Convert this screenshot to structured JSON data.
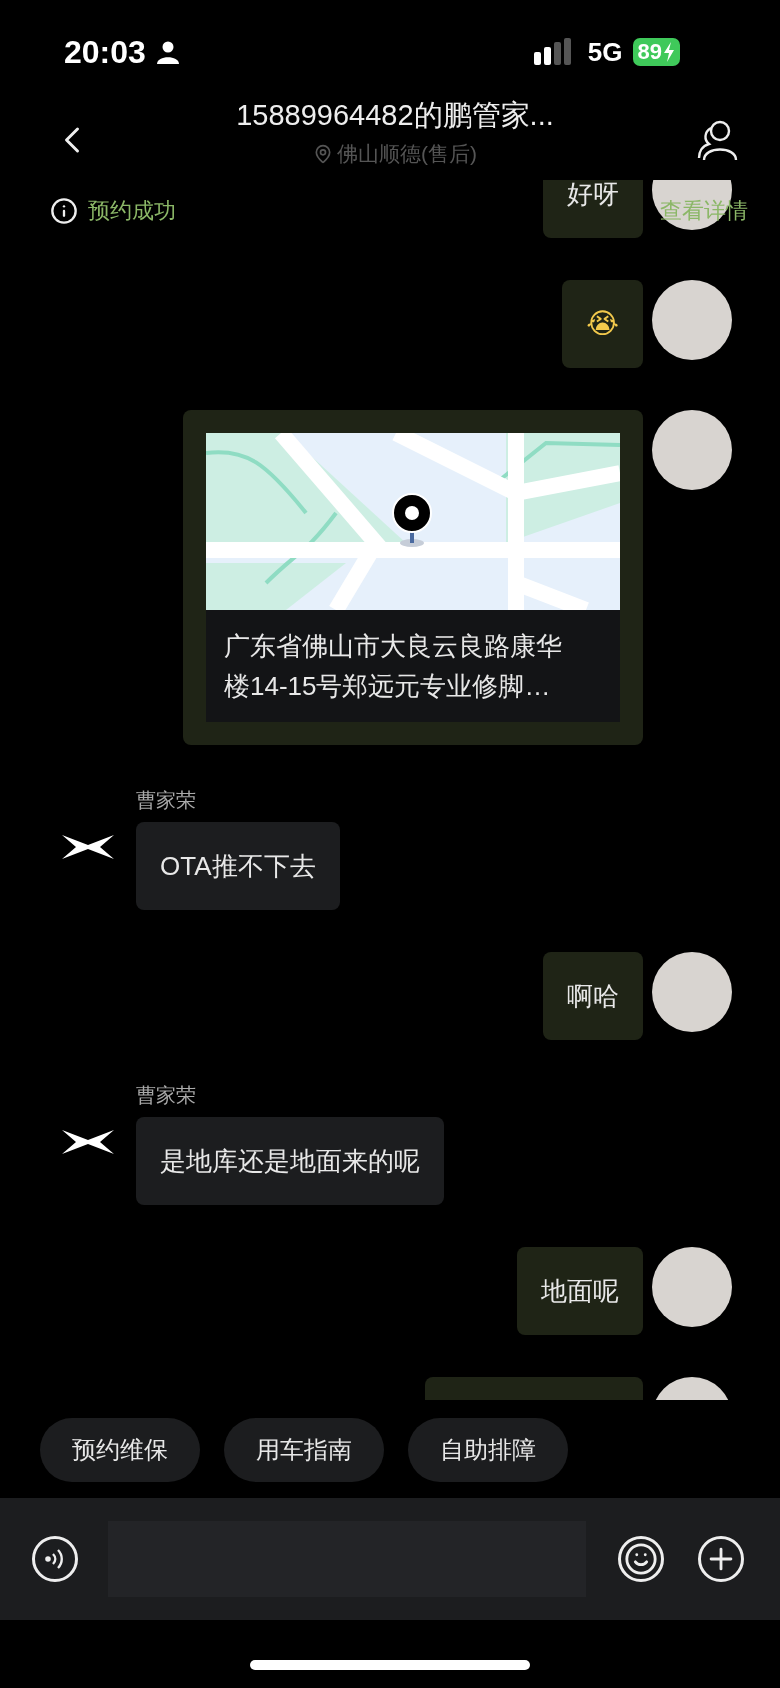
{
  "status_bar": {
    "time": "20:03",
    "network": "5G",
    "battery": "89"
  },
  "header": {
    "title": "15889964482的鹏管家...",
    "subtitle": "佛山顺德(售后)"
  },
  "banner": {
    "status": "预约成功",
    "link": "查看详情"
  },
  "messages": [
    {
      "outgoing": true,
      "kind": "text",
      "text": "好呀"
    },
    {
      "outgoing": true,
      "kind": "emoji",
      "text": "😭"
    },
    {
      "outgoing": true,
      "kind": "location",
      "address": "广东省佛山市大良云良路康华楼14-15号郑远元专业修脚…"
    },
    {
      "outgoing": false,
      "kind": "text",
      "sender": "曹家荣",
      "text": "OTA推不下去"
    },
    {
      "outgoing": true,
      "kind": "text",
      "text": "啊哈"
    },
    {
      "outgoing": false,
      "kind": "text",
      "sender": "曹家荣",
      "text": "是地库还是地面来的呢"
    },
    {
      "outgoing": true,
      "kind": "text",
      "text": "地面呢"
    },
    {
      "outgoing": true,
      "kind": "text"
    }
  ],
  "quick_replies": [
    "预约维保",
    "用车指南",
    "自助排障"
  ]
}
